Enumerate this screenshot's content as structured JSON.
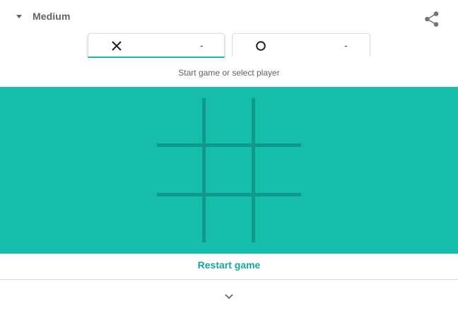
{
  "header": {
    "difficulty_label": "Medium",
    "difficulty_icon": "caret-down-icon",
    "share_icon": "share-icon"
  },
  "players": [
    {
      "mark": "X",
      "mark_icon": "cross-icon",
      "score": "-",
      "active": true
    },
    {
      "mark": "O",
      "mark_icon": "circle-icon",
      "score": "-",
      "active": false
    }
  ],
  "status_text": "Start game or select player",
  "board": {
    "cells": [
      "",
      "",
      "",
      "",
      "",
      "",
      "",
      "",
      ""
    ]
  },
  "restart_label": "Restart game",
  "expand_icon": "chevron-down-icon",
  "colors": {
    "board_bg": "#17bdab",
    "grid_line": "#0e998b",
    "accent": "#17bdab",
    "restart_text": "#17a59a",
    "muted_text": "#5f6368"
  }
}
